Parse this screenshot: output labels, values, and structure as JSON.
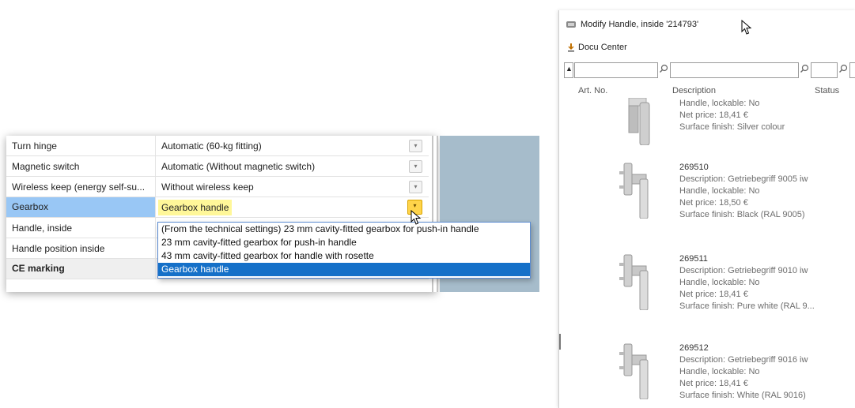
{
  "property_grid": {
    "rows": [
      {
        "name": "Turn hinge",
        "value": "Automatic (60-kg fitting)"
      },
      {
        "name": "Magnetic switch",
        "value": "Automatic (Without magnetic switch)"
      },
      {
        "name": "Wireless keep (energy self-su...",
        "value": "Without wireless keep"
      },
      {
        "name": "Gearbox",
        "value": "Gearbox handle"
      },
      {
        "name": "Handle, inside",
        "value": ""
      },
      {
        "name": "Handle position inside",
        "value": ""
      },
      {
        "name": "CE marking",
        "value": ""
      }
    ],
    "dropdown_options": [
      "(From the technical settings) 23 mm cavity-fitted gearbox for push-in handle",
      "23 mm cavity-fitted gearbox for push-in handle",
      "43 mm cavity-fitted gearbox for handle with rosette",
      "Gearbox handle"
    ],
    "selected_option_index": 3,
    "colors": {
      "selected_row": "#99c7f5",
      "selected_value": "#fff799",
      "dropdown_highlight": "#1570c8",
      "side_panel": "#a6bccb"
    }
  },
  "dialog": {
    "title": "Modify Handle, inside '214793'",
    "docu_center": "Docu Center",
    "columns": {
      "art_no": "Art. No.",
      "description": "Description",
      "status": "Status"
    },
    "items": [
      {
        "code": "",
        "lines": [
          "Handle, lockable: No",
          "Net price: 18,41 €",
          "Surface finish: Silver colour"
        ]
      },
      {
        "code": "269510",
        "lines": [
          "Description: Getriebegriff 9005 iw",
          "Handle, lockable: No",
          "Net price: 18,50 €",
          "Surface finish: Black (RAL 9005)"
        ]
      },
      {
        "code": "269511",
        "lines": [
          "Description: Getriebegriff 9010 iw",
          "Handle, lockable: No",
          "Net price: 18,41 €",
          "Surface finish: Pure white (RAL 9..."
        ]
      },
      {
        "code": "269512",
        "lines": [
          "Description: Getriebegriff 9016 iw",
          "Handle, lockable: No",
          "Net price: 18,41 €",
          "Surface finish: White (RAL 9016)"
        ]
      }
    ]
  }
}
